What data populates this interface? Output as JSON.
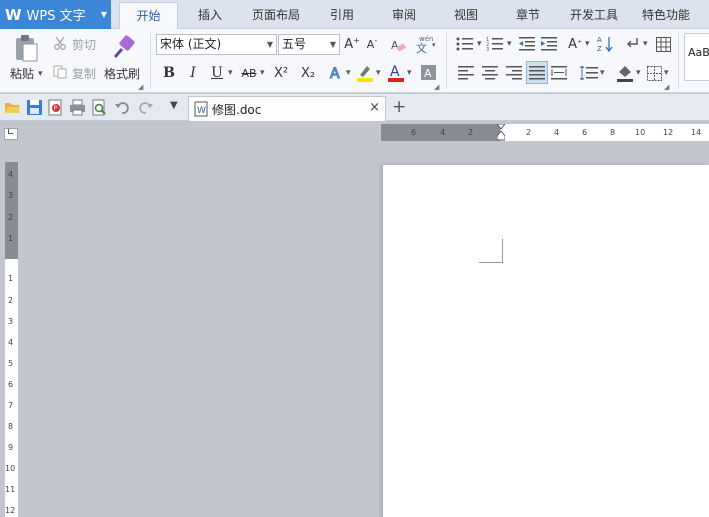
{
  "app": {
    "title": "WPS 文字"
  },
  "tabs": [
    "开始",
    "插入",
    "页面布局",
    "引用",
    "审阅",
    "视图",
    "章节",
    "开发工具",
    "特色功能"
  ],
  "ribbon": {
    "cut": "剪切",
    "copy": "复制",
    "paste": "粘贴",
    "format_painter": "格式刷",
    "font_name": "宋体 (正文)",
    "font_size": "五号",
    "style_preview": "AaBl",
    "bold": "B",
    "italic": "I",
    "underline": "U",
    "strike": "AB",
    "superscript": "X²",
    "subscript": "X₂"
  },
  "document": {
    "tab_name": "修图.doc",
    "close": "×",
    "new_tab": "+"
  },
  "ruler": {
    "h_ticks": [
      "6",
      "4",
      "2",
      "2",
      "4",
      "6",
      "8",
      "10",
      "12",
      "14"
    ],
    "v_ticks": [
      "4",
      "3",
      "2",
      "1",
      "1",
      "2",
      "3",
      "4",
      "5",
      "6",
      "7",
      "8",
      "9",
      "10",
      "11",
      "12"
    ]
  },
  "colors": {
    "app_button": "#3b86d6",
    "active_tab_text": "#2a5ea8",
    "font_color_bar": "#e02020",
    "highlight_bar": "#f5e600"
  }
}
